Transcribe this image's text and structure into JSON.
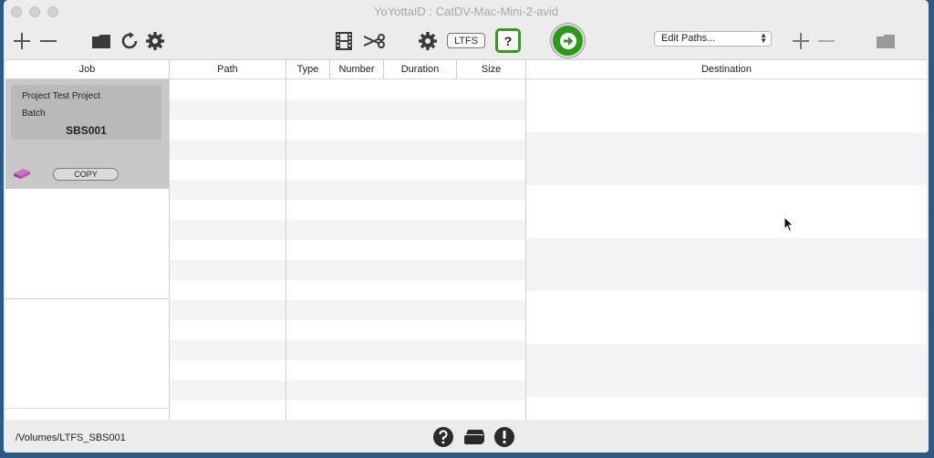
{
  "window": {
    "title": "YoYottaID : CatDV-Mac-Mini-2-avid"
  },
  "toolbar": {
    "ltfs_label": "LTFS",
    "help_label": "?",
    "edit_paths": {
      "selected": "Edit Paths..."
    }
  },
  "table": {
    "headers": {
      "job": "Job",
      "path": "Path",
      "type": "Type",
      "number": "Number",
      "duration": "Duration",
      "size": "Size",
      "destination": "Destination"
    }
  },
  "job": {
    "project_label": "Project",
    "project_value": "Test Project",
    "batch_label": "Batch",
    "batch_value": "SBS001",
    "copy_label": "COPY"
  },
  "status": {
    "path": "/Volumes/LTFS_SBS001"
  },
  "colors": {
    "accent_green": "#2b9a17",
    "desktop_blue": "#2c5a86"
  }
}
